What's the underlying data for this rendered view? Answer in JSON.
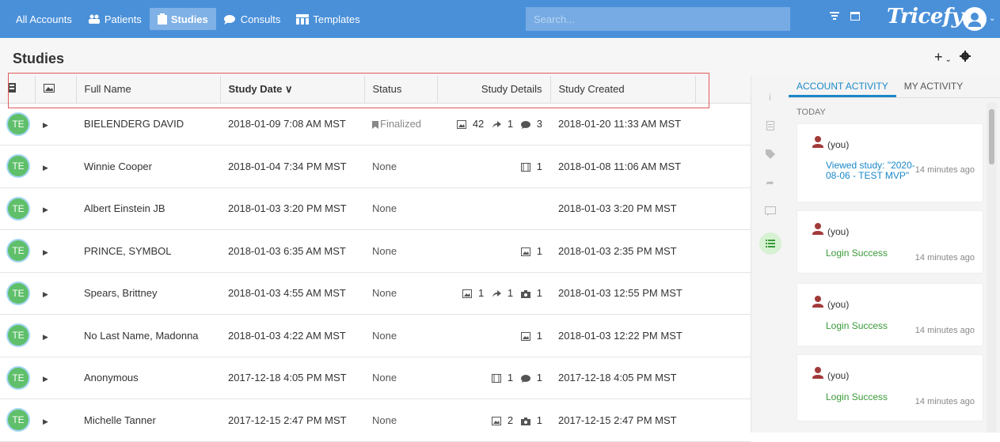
{
  "nav": {
    "all_accounts": "All Accounts",
    "patients": "Patients",
    "studies": "Studies",
    "consults": "Consults",
    "templates": "Templates"
  },
  "search": {
    "placeholder": "Search..."
  },
  "brand": "Tricefy",
  "page": {
    "title": "Studies"
  },
  "columns": [
    "",
    "",
    "Full Name",
    "Study Date ∨",
    "Status",
    "Study Details",
    "Study Created"
  ],
  "rows": [
    {
      "avatar": "TE",
      "name": "BIELENDERG DAVID",
      "date": "2018-01-09 7:08 AM MST",
      "status": "Finalized",
      "details": [
        {
          "icon": "image-icon",
          "count": "42"
        },
        {
          "icon": "share-icon",
          "count": "1"
        },
        {
          "icon": "comment-icon",
          "count": "3"
        }
      ],
      "created": "2018-01-20 11:33 AM MST"
    },
    {
      "avatar": "TE",
      "name": "Winnie Cooper",
      "date": "2018-01-04 7:34 PM MST",
      "status": "None",
      "details": [
        {
          "icon": "film-icon",
          "count": "1"
        }
      ],
      "created": "2018-01-08 11:06 AM MST"
    },
    {
      "avatar": "TE",
      "name": "Albert Einstein JB",
      "date": "2018-01-03 3:20 PM MST",
      "status": "None",
      "details": [],
      "created": "2018-01-03 3:20 PM MST"
    },
    {
      "avatar": "TE",
      "name": "PRINCE, SYMBOL",
      "date": "2018-01-03 6:35 AM MST",
      "status": "None",
      "details": [
        {
          "icon": "image-icon",
          "count": "1"
        }
      ],
      "created": "2018-01-03 2:35 PM MST"
    },
    {
      "avatar": "TE",
      "name": "Spears, Brittney",
      "date": "2018-01-03 4:55 AM MST",
      "status": "None",
      "details": [
        {
          "icon": "image-icon",
          "count": "1"
        },
        {
          "icon": "share-icon",
          "count": "1"
        },
        {
          "icon": "camera-icon",
          "count": "1"
        }
      ],
      "created": "2018-01-03 12:55 PM MST"
    },
    {
      "avatar": "TE",
      "name": "No Last Name, Madonna",
      "date": "2018-01-03 4:22 AM MST",
      "status": "None",
      "details": [
        {
          "icon": "image-icon",
          "count": "1"
        }
      ],
      "created": "2018-01-03 12:22 PM MST"
    },
    {
      "avatar": "TE",
      "name": "Anonymous",
      "date": "2017-12-18 4:05 PM MST",
      "status": "None",
      "details": [
        {
          "icon": "film-icon",
          "count": "1"
        },
        {
          "icon": "comment-icon",
          "count": "1"
        }
      ],
      "created": "2017-12-18 4:05 PM MST"
    },
    {
      "avatar": "TE",
      "name": "Michelle Tanner",
      "date": "2017-12-15 2:47 PM MST",
      "status": "None",
      "details": [
        {
          "icon": "image-icon",
          "count": "2"
        },
        {
          "icon": "camera-icon",
          "count": "1"
        }
      ],
      "created": "2017-12-15 2:47 PM MST"
    }
  ],
  "activity": {
    "tabs": [
      "ACCOUNT ACTIVITY",
      "MY ACTIVITY"
    ],
    "section": "TODAY",
    "items": [
      {
        "who": "(you)",
        "action": "Viewed study: \"2020-08-06 - TEST MVP\"",
        "ago": "14 minutes ago"
      },
      {
        "who": "(you)",
        "action": "Login Success",
        "ago": "14 minutes ago"
      },
      {
        "who": "(you)",
        "action": "Login Success",
        "ago": "14 minutes ago"
      },
      {
        "who": "(you)",
        "action": "Login Success",
        "ago": "14 minutes ago"
      }
    ]
  }
}
